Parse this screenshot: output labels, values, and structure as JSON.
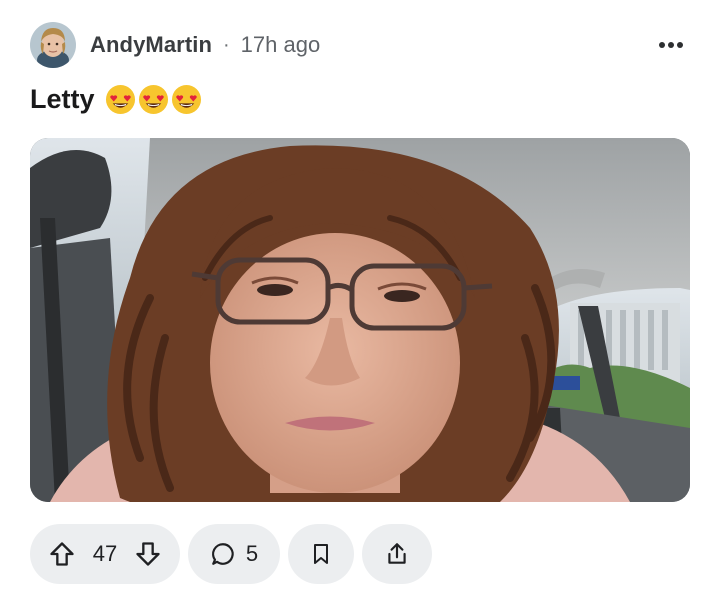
{
  "post": {
    "author": "AndyMartin",
    "separator": "·",
    "time_ago": "17h ago",
    "title": "Letty",
    "emojis": [
      "smiling-face-with-heart-eyes",
      "smiling-face-with-heart-eyes",
      "smiling-face-with-heart-eyes"
    ]
  },
  "actions": {
    "upvote_count": "47",
    "comment_count": "5"
  },
  "icons": {
    "menu": "more-horizontal-icon",
    "upvote": "arrow-up-icon",
    "downvote": "arrow-down-icon",
    "comment": "speech-bubble-icon",
    "save": "bookmark-icon",
    "share": "share-icon"
  },
  "colors": {
    "pill_background": "#eceef0",
    "text_primary": "#1a1a1b",
    "text_secondary": "#5f6368"
  }
}
